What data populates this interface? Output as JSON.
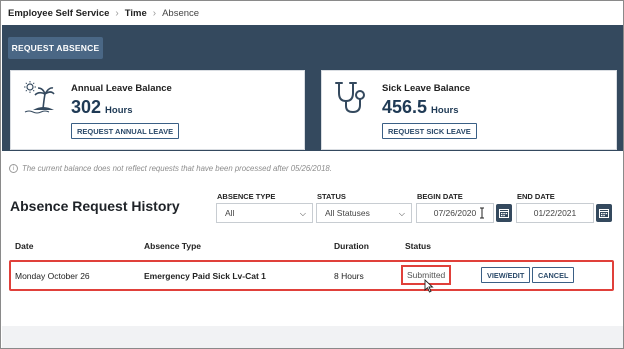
{
  "breadcrumb": {
    "root": "Employee Self Service",
    "section": "Time",
    "current": "Absence"
  },
  "actions": {
    "request_absence": "REQUEST ABSENCE"
  },
  "annual": {
    "title": "Annual Leave Balance",
    "value": "302",
    "unit": "Hours",
    "button": "REQUEST ANNUAL LEAVE",
    "icon": "beach-island-icon"
  },
  "sick": {
    "title": "Sick Leave Balance",
    "value": "456.5",
    "unit": "Hours",
    "button": "REQUEST SICK LEAVE",
    "icon": "stethoscope-icon"
  },
  "note": {
    "icon": "i",
    "text": "The current balance does not reflect requests that have been processed after 05/26/2018."
  },
  "history": {
    "title": "Absence Request History",
    "filters": {
      "absence_type": {
        "label": "ABSENCE TYPE",
        "value": "All"
      },
      "status": {
        "label": "STATUS",
        "value": "All Statuses"
      },
      "begin_date": {
        "label": "BEGIN DATE",
        "value": "07/26/2020"
      },
      "end_date": {
        "label": "END DATE",
        "value": "01/22/2021"
      }
    },
    "columns": {
      "date": "Date",
      "type": "Absence Type",
      "duration": "Duration",
      "status": "Status"
    },
    "rows": [
      {
        "date": "Monday October 26",
        "type": "Emergency Paid Sick Lv-Cat 1",
        "duration": "8 Hours",
        "status": "Submitted",
        "view_edit": "VIEW/EDIT",
        "cancel": "CANCEL"
      }
    ]
  },
  "colors": {
    "header": "#34495e",
    "accent": "#4a6785",
    "highlight": "#e0403a"
  }
}
